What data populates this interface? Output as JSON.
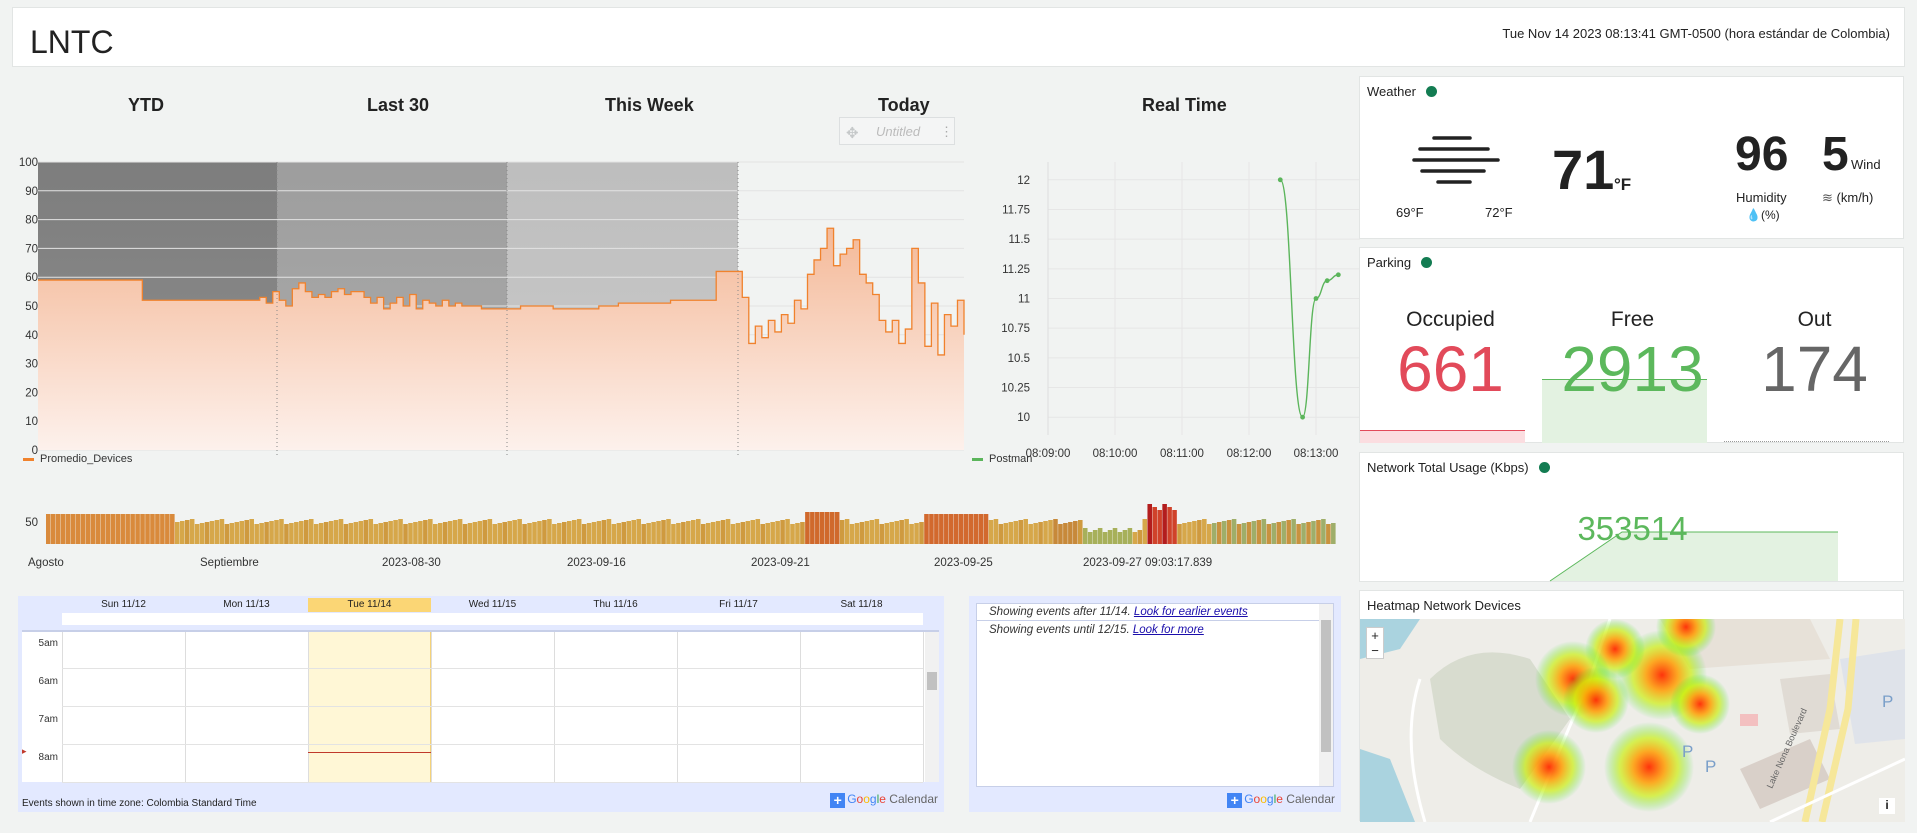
{
  "header": {
    "title": "LNTC",
    "clock": "Tue Nov 14 2023 08:13:41 GMT-0500 (hora estándar de Colombia)"
  },
  "periods": [
    "YTD",
    "Last 30",
    "This Week",
    "Today",
    "Real Time"
  ],
  "toolbar": {
    "label": "Untitled"
  },
  "chart_data": [
    {
      "type": "area",
      "y_ticks": [
        "100",
        "90",
        "80",
        "70",
        "60",
        "50",
        "40",
        "30",
        "20",
        "10",
        "0"
      ],
      "ylim": [
        0,
        100
      ],
      "legend": "Promedio_Devices",
      "series": [
        {
          "name": "Promedio_Devices",
          "color": "#f0822d",
          "values": [
            59,
            59,
            59,
            59,
            59,
            59,
            59,
            59,
            59,
            59,
            59,
            59,
            59,
            59,
            59,
            59,
            52,
            52,
            52,
            52,
            52,
            52,
            52,
            52,
            52,
            52,
            52,
            52,
            52,
            52,
            52,
            52,
            52,
            52,
            53,
            51,
            55,
            52,
            50,
            56,
            58,
            55,
            53,
            54,
            53,
            55,
            56,
            54,
            55,
            55,
            53,
            51,
            53,
            49,
            51,
            53,
            50,
            54,
            49,
            52,
            51,
            50,
            52,
            50,
            51,
            50,
            50,
            50,
            49,
            49,
            49,
            49,
            49,
            49,
            50,
            50,
            50,
            50,
            50,
            49,
            49,
            49,
            49,
            49,
            49,
            49,
            50,
            50,
            50,
            51,
            51,
            51,
            51,
            51,
            51,
            51,
            51,
            52,
            52,
            52,
            52,
            52,
            52,
            52,
            62,
            62,
            62,
            62,
            53,
            37,
            43,
            39,
            45,
            41,
            47,
            44,
            52,
            49,
            61,
            66,
            70,
            77,
            64,
            68,
            70,
            73,
            61,
            58,
            54,
            45,
            41,
            45,
            37,
            42,
            70,
            58,
            36,
            51,
            33,
            47,
            43,
            52,
            40
          ]
        }
      ]
    },
    {
      "type": "line",
      "y_ticks": [
        "12",
        "11.75",
        "11.5",
        "11.25",
        "11",
        "10.75",
        "10.5",
        "10.25",
        "10"
      ],
      "x_ticks": [
        "08:09:00",
        "08:10:00",
        "08:11:00",
        "08:12:00",
        "08:13:00"
      ],
      "ylim": [
        9.85,
        12.15
      ],
      "legend": "Postman",
      "series": [
        {
          "name": "Postman",
          "color": "#5bb55b",
          "x": [
            "08:12:28",
            "08:12:48",
            "08:13:00",
            "08:13:10",
            "08:13:20"
          ],
          "values": [
            12,
            10,
            11,
            11.15,
            11.2
          ]
        }
      ]
    },
    {
      "type": "bar",
      "y_ticks": [
        "50"
      ],
      "x_labels": [
        "Agosto",
        "Septiembre",
        "2023-08-30",
        "2023-09-16",
        "2023-09-21",
        "2023-09-25",
        "2023-09-27 09:03:17.839"
      ]
    }
  ],
  "weather": {
    "title": "Weather",
    "temp": "71",
    "unit": "°F",
    "low": "69°F",
    "high": "72°F",
    "humidity_value": "96",
    "humidity_label": "Humidity",
    "humidity_unit": "(%)",
    "wind_value": "5",
    "wind_label": "Wind",
    "wind_unit": "(km/h)"
  },
  "parking": {
    "title": "Parking",
    "occupied_label": "Occupied",
    "occupied_value": "661",
    "free_label": "Free",
    "free_value": "2913",
    "out_label": "Out",
    "out_value": "174",
    "colors": {
      "occupied": "#e24a5a",
      "free": "#5cb85c",
      "out": "#666666"
    }
  },
  "network": {
    "title": "Network Total Usage (Kbps)",
    "value": "353514"
  },
  "heatmap": {
    "title": "Heatmap Network Devices",
    "zoom_in": "+",
    "zoom_out": "−",
    "road_label": "Lake Nona Boulevard",
    "info": "i",
    "parking_marker": "P"
  },
  "calendar": {
    "days": [
      "Sun 11/12",
      "Mon 11/13",
      "Tue 11/14",
      "Wed 11/15",
      "Thu 11/16",
      "Fri 11/17",
      "Sat 11/18"
    ],
    "hours": [
      "5am",
      "6am",
      "7am",
      "8am"
    ],
    "timezone_note": "Events shown in time zone: Colombia Standard Time",
    "brand_suffix": "Calendar"
  },
  "agenda": {
    "line1": "Showing events after 11/14.",
    "link1": "Look for earlier events",
    "line2": "Showing events until 12/15.",
    "link2": "Look for more",
    "brand_suffix": "Calendar"
  }
}
